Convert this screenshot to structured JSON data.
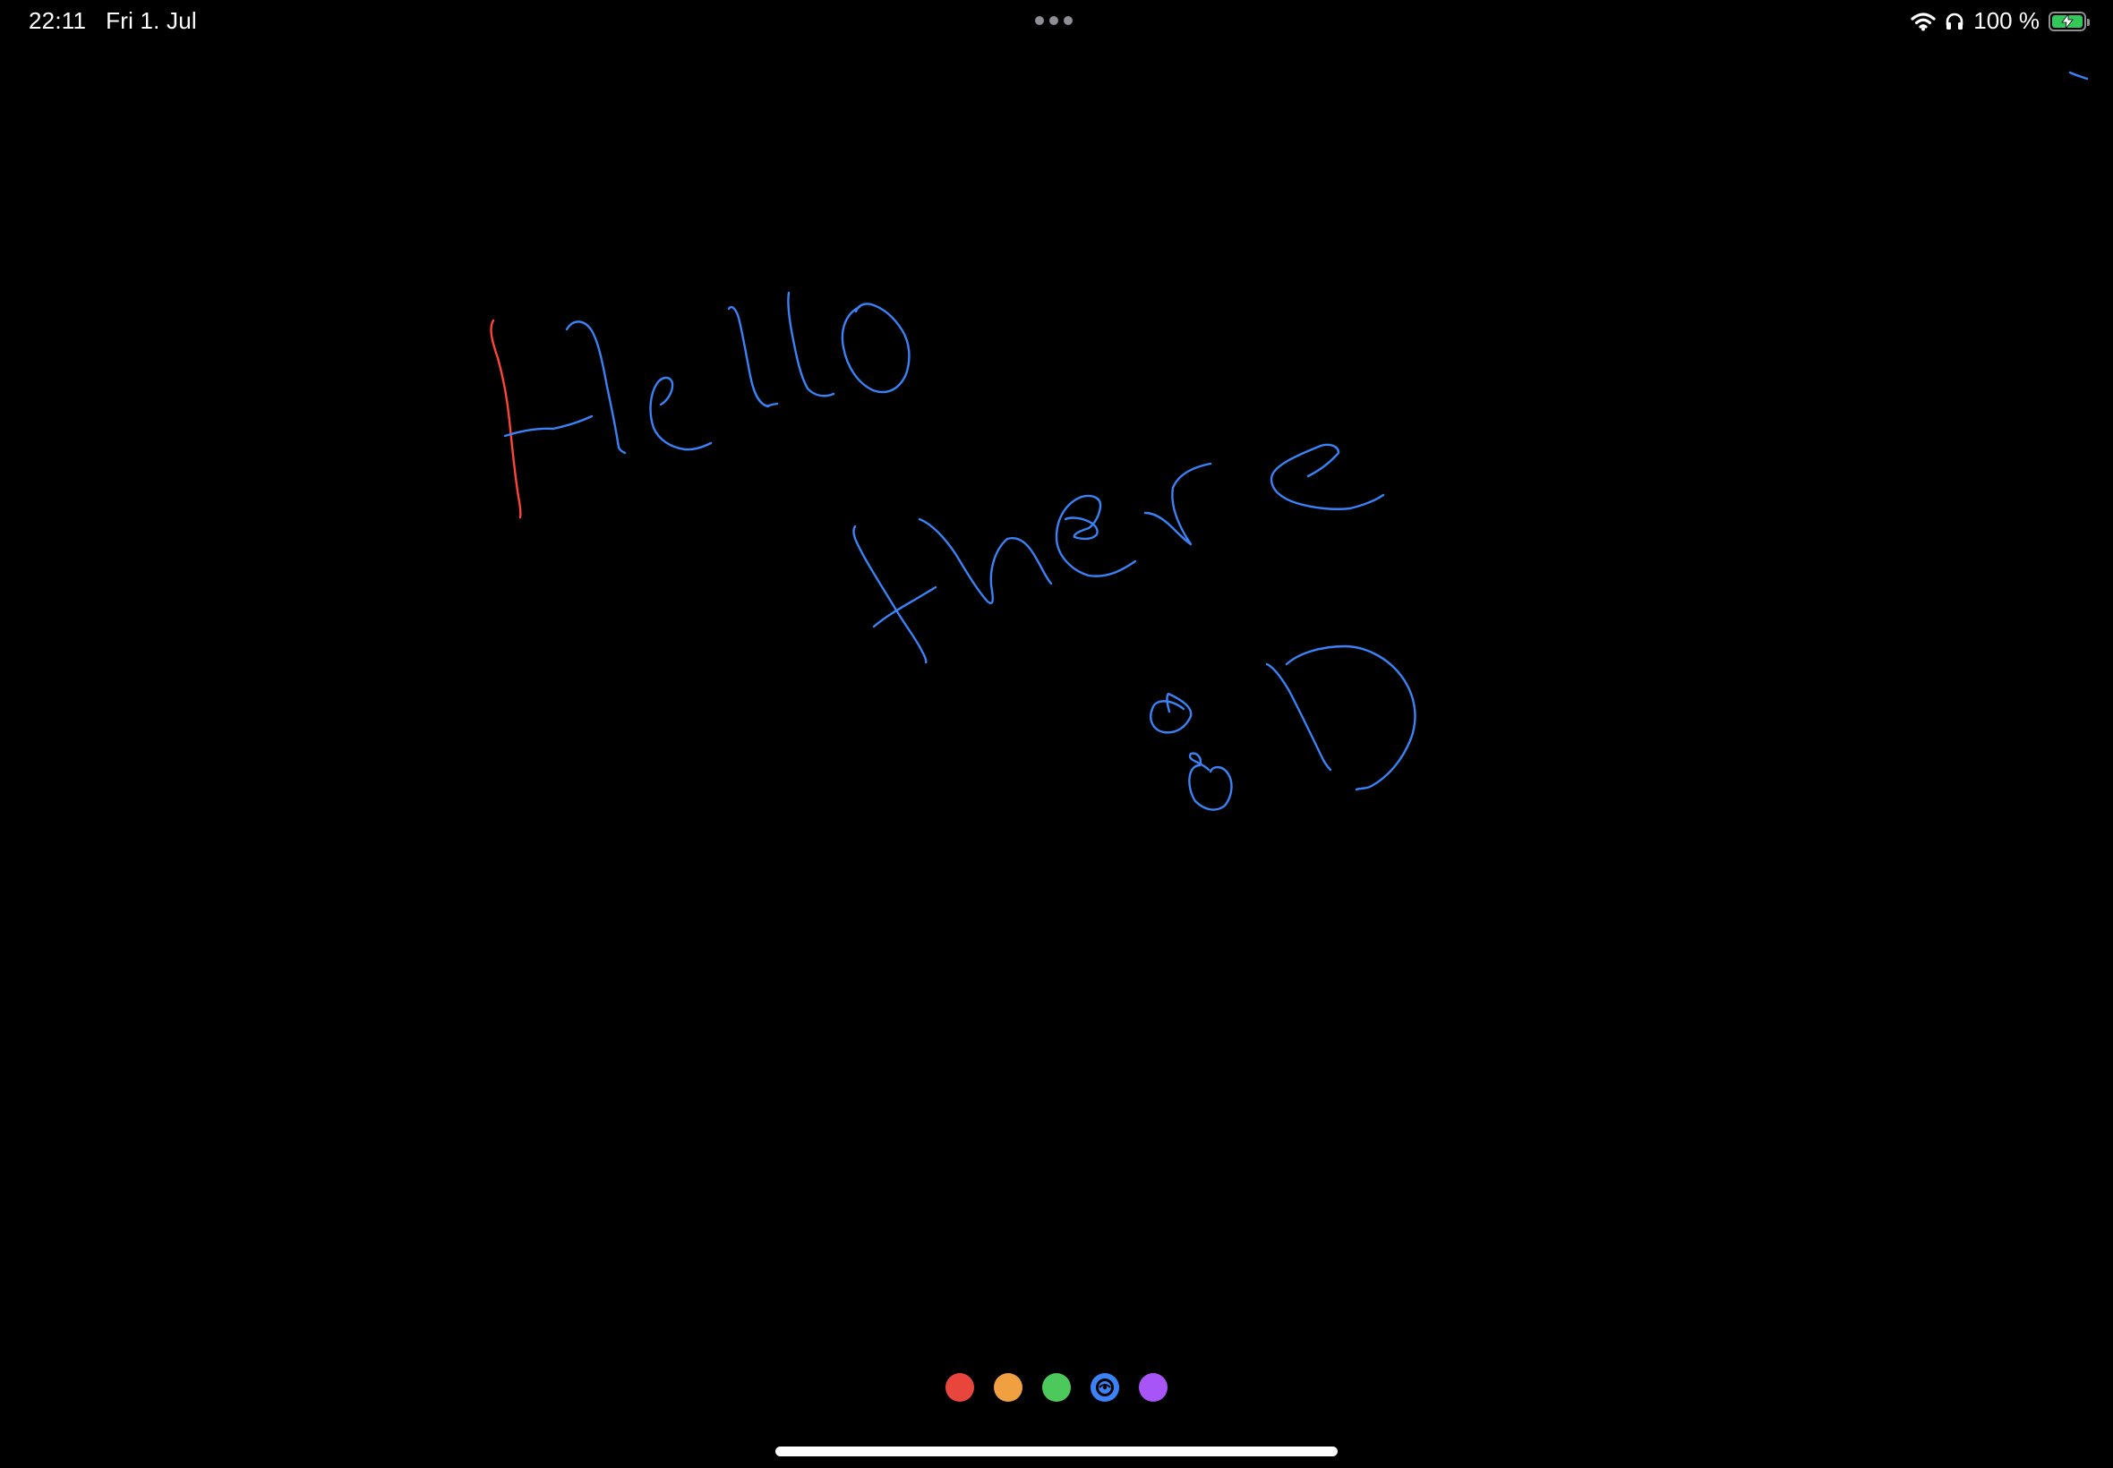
{
  "status_bar": {
    "time": "22:11",
    "date": "Fri 1. Jul",
    "battery_percent": "100 %",
    "battery_level": 1.0,
    "icons": [
      "wifi-icon",
      "headphones-icon",
      "battery-charging-icon"
    ]
  },
  "multitasking": {
    "icon": "more-dots-icon"
  },
  "drawing": {
    "strokes_colors": {
      "red": "#ff453a",
      "blue": "#3b82f6"
    }
  },
  "palette": {
    "colors": [
      {
        "name": "red",
        "hex": "#e8453c"
      },
      {
        "name": "orange",
        "hex": "#f0a040"
      },
      {
        "name": "green",
        "hex": "#4cc95a"
      },
      {
        "name": "blue",
        "hex": "#3b82f6",
        "selected": true
      },
      {
        "name": "purple",
        "hex": "#a855f7"
      }
    ]
  }
}
